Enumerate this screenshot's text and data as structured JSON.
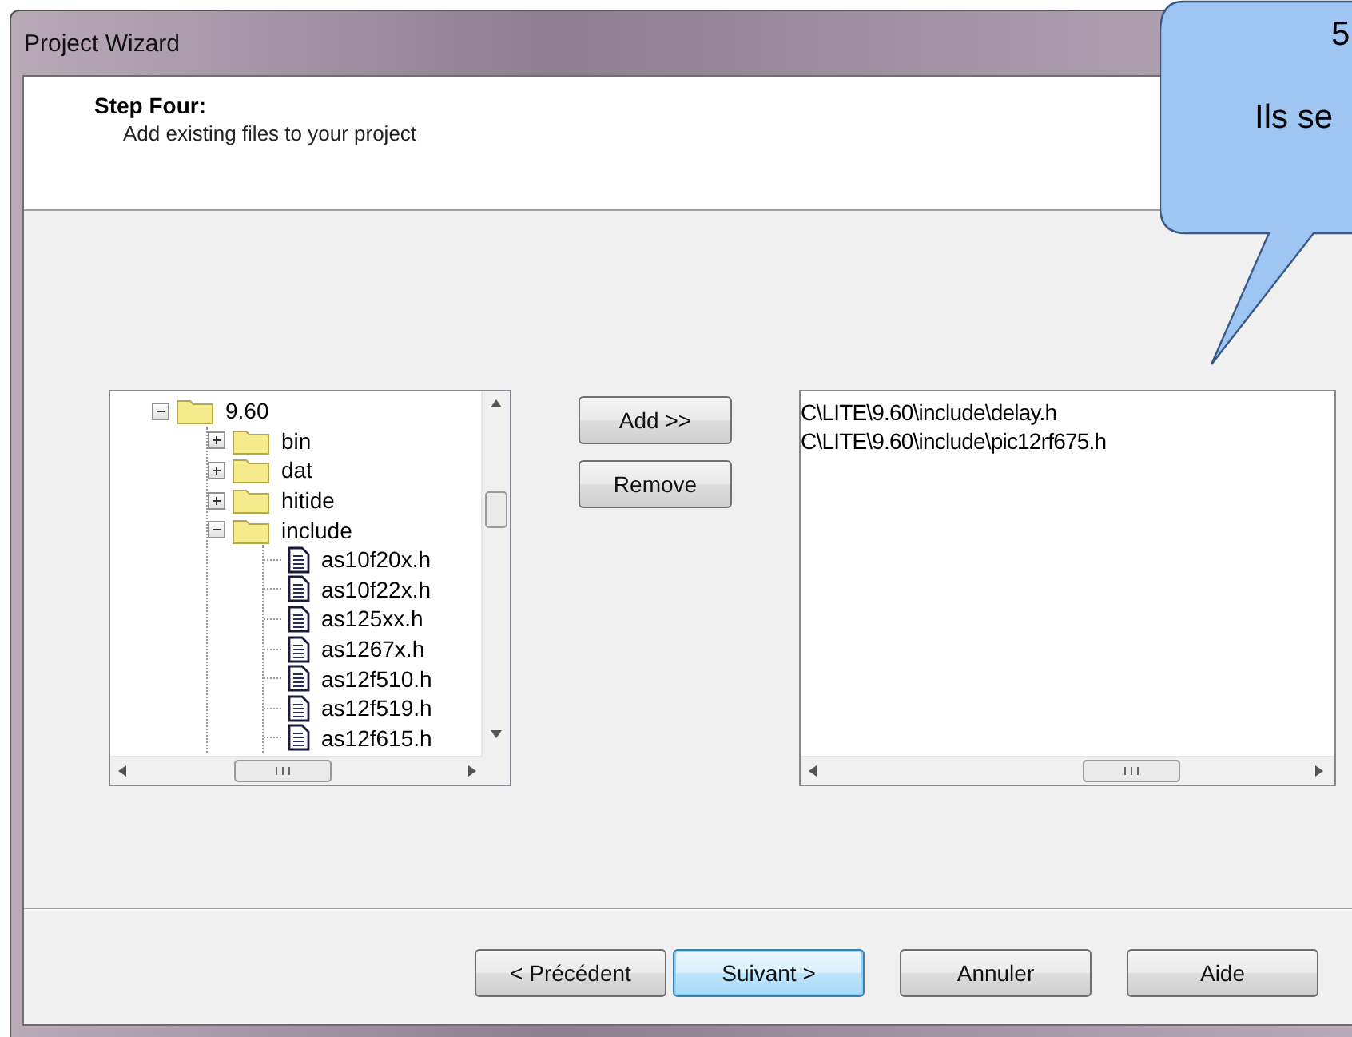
{
  "window": {
    "title": "Project Wizard"
  },
  "header": {
    "step": "Step Four:",
    "description": "Add existing files to your project"
  },
  "tree": [
    {
      "kind": "folder",
      "label": "9.60",
      "expanded": true,
      "children": [
        {
          "kind": "folder",
          "label": "bin",
          "expanded": false
        },
        {
          "kind": "folder",
          "label": "dat",
          "expanded": false
        },
        {
          "kind": "folder",
          "label": "hitide",
          "expanded": false
        },
        {
          "kind": "folder",
          "label": "include",
          "expanded": true,
          "children": [
            {
              "kind": "file",
              "label": "as10f20x.h"
            },
            {
              "kind": "file",
              "label": "as10f22x.h"
            },
            {
              "kind": "file",
              "label": "as125xx.h"
            },
            {
              "kind": "file",
              "label": "as1267x.h"
            },
            {
              "kind": "file",
              "label": "as12f510.h"
            },
            {
              "kind": "file",
              "label": "as12f519.h"
            },
            {
              "kind": "file",
              "label": "as12f615.h"
            }
          ]
        }
      ]
    }
  ],
  "middle_buttons": [
    "Add >>",
    "Remove"
  ],
  "project_files": [
    "C\\LITE\\9.60\\include\\delay.h",
    "C\\LITE\\9.60\\include\\pic12rf675.h"
  ],
  "footer_buttons": [
    {
      "label": "< Précédent",
      "selected": false
    },
    {
      "label": "Suivant >",
      "selected": true
    },
    {
      "label": "Annuler",
      "selected": false
    },
    {
      "label": "Aide",
      "selected": false
    }
  ],
  "callout": {
    "lines": [
      "5",
      "Ils se"
    ]
  }
}
